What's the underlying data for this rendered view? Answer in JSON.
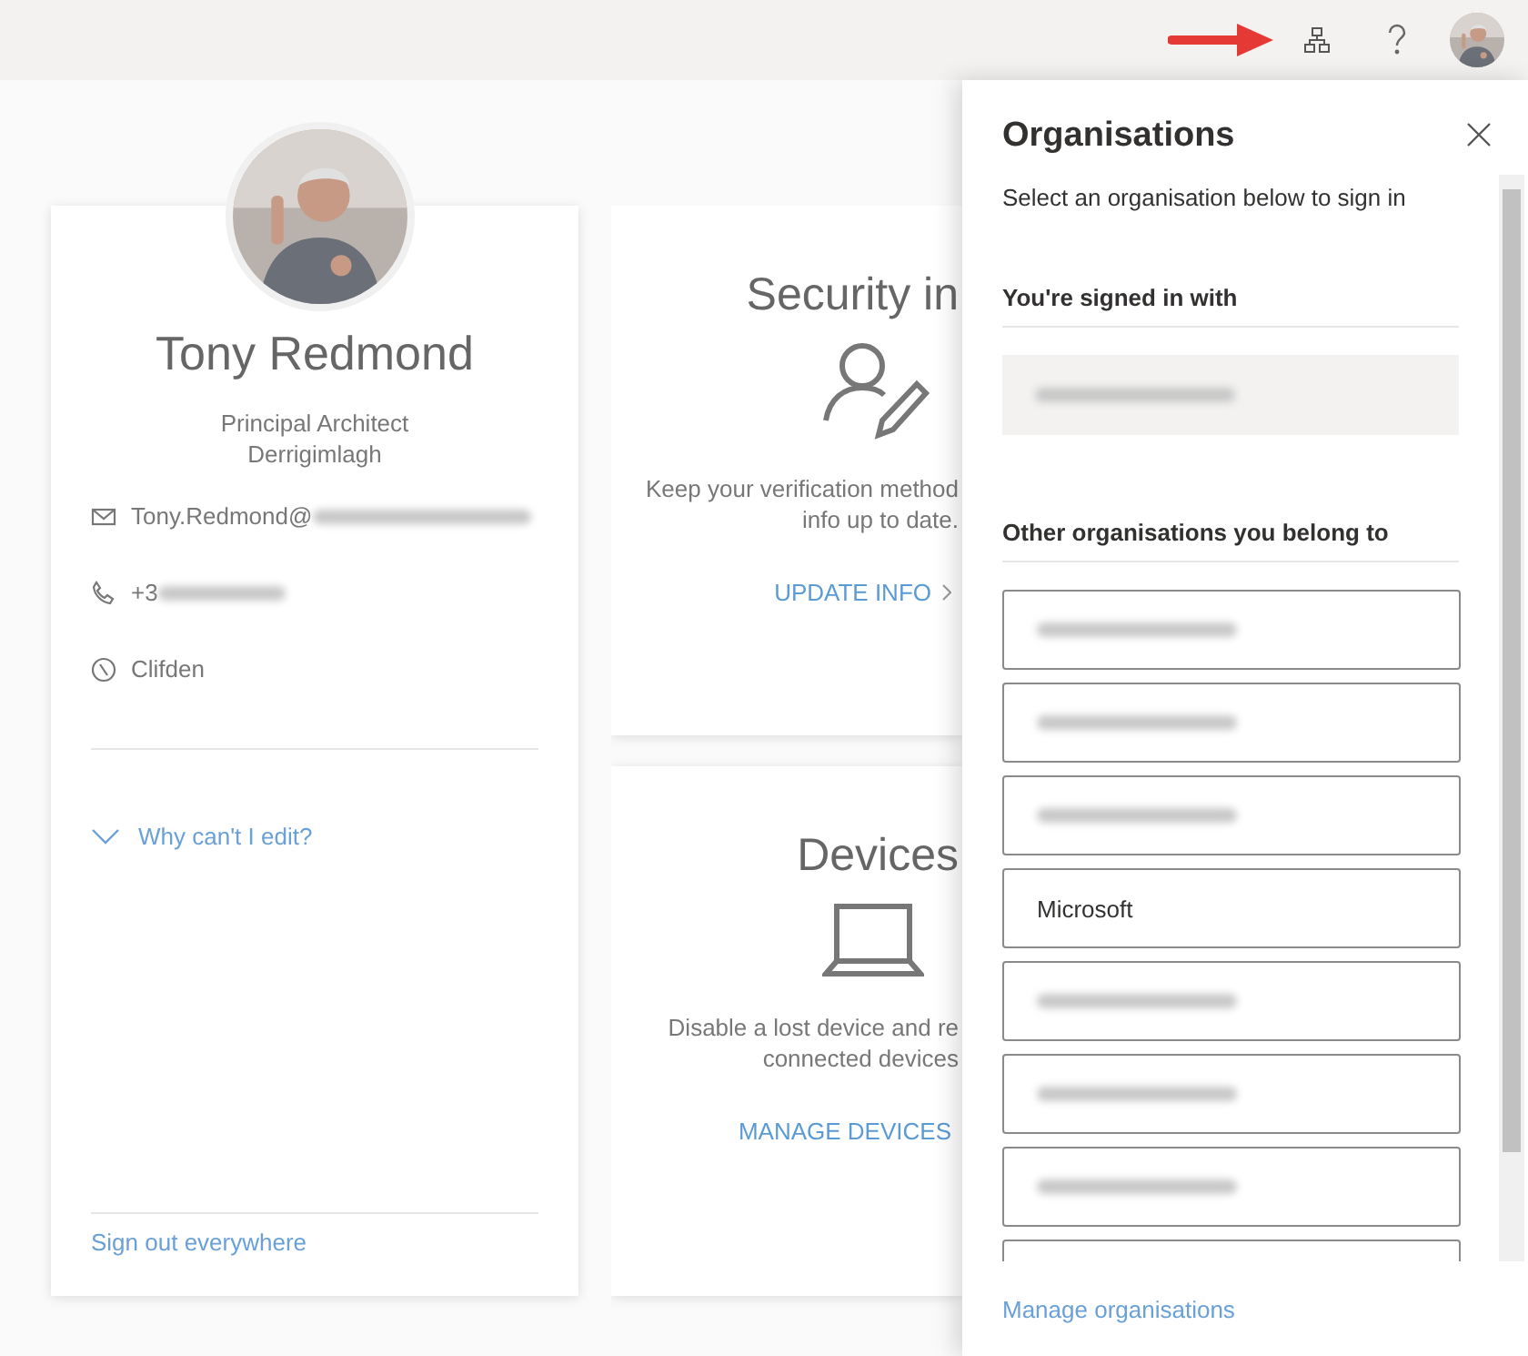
{
  "profile": {
    "name": "Tony Redmond",
    "title": "Principal Architect",
    "location_line": "Derrigimlagh",
    "contacts": [
      {
        "kind": "email",
        "text": "Tony.Redmond@",
        "blurred": true
      },
      {
        "kind": "phone",
        "text": "+3",
        "blurred": true
      },
      {
        "kind": "location",
        "text": "Clifden",
        "blurred": false
      }
    ],
    "why_link": "Why can't I edit?",
    "sign_out": "Sign out everywhere"
  },
  "cards": [
    {
      "kind": "security",
      "title": "Security in",
      "lines": [
        "Keep your verification method",
        "info up to date."
      ],
      "action": "UPDATE INFO",
      "chevron": true
    },
    {
      "kind": "devices",
      "title": "Devices",
      "lines": [
        "Disable a lost device and re",
        "connected devices"
      ],
      "action": "MANAGE DEVICES",
      "chevron": false
    }
  ],
  "panel": {
    "title": "Organisations",
    "subtitle": "Select an organisation below to sign in",
    "signed_in_heading": "You're signed in with",
    "signed_in": {
      "kind": "blurred"
    },
    "others_heading": "Other organisations you belong to",
    "organisations": [
      {
        "kind": "blurred"
      },
      {
        "kind": "blurred"
      },
      {
        "kind": "blurred"
      },
      {
        "kind": "text",
        "name": "Microsoft"
      },
      {
        "kind": "blurred"
      },
      {
        "kind": "blurred"
      },
      {
        "kind": "blurred"
      },
      {
        "kind": "cut"
      }
    ],
    "footer_link": "Manage organisations"
  }
}
